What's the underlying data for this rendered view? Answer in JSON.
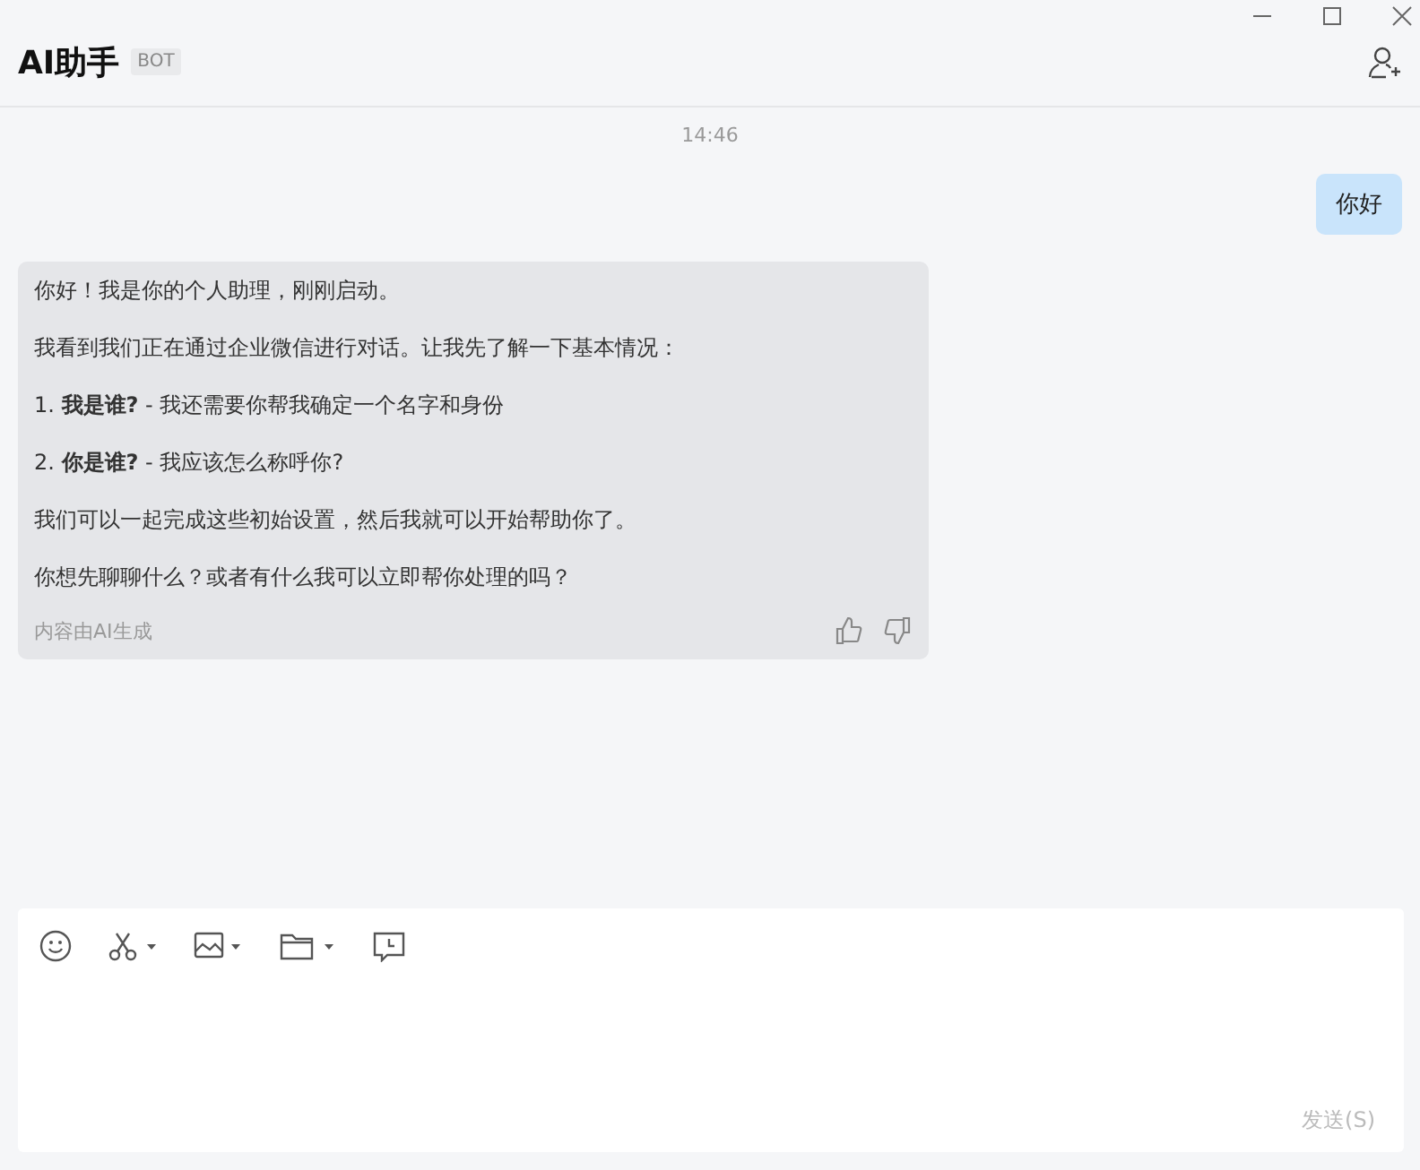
{
  "header": {
    "title": "AI助手",
    "badge": "BOT"
  },
  "timestamp": "14:46",
  "messages": [
    {
      "kind": "user",
      "text": "你好"
    },
    {
      "kind": "bot",
      "paragraphs": [
        "你好！我是你的个人助理，刚刚启动。",
        "我看到我们正在通过企业微信进行对话。让我先了解一下基本情况：",
        "1. **我是谁?**  - 我还需要你帮我确定一个名字和身份",
        "2. **你是谁?**  - 我应该怎么称呼你?",
        "我们可以一起完成这些初始设置，然后我就可以开始帮助你了。",
        "你想先聊聊什么？或者有什么我可以立即帮你处理的吗？"
      ],
      "footnote": "内容由AI生成"
    }
  ],
  "send_button": {
    "label": "发送(S)",
    "disabled": true
  }
}
